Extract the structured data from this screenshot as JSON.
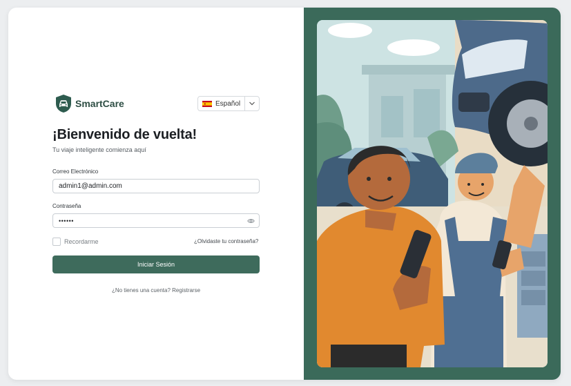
{
  "brand": {
    "name": "SmartCare",
    "logo_icon": "car-shield-icon",
    "color": "#2e4e44"
  },
  "language": {
    "selected": "Español",
    "flag_icon": "spain-flag-icon",
    "dropdown_icon": "chevron-down-icon"
  },
  "login": {
    "title": "¡Bienvenido de vuelta!",
    "subtitle": "Tu viaje inteligente comienza aquí",
    "email_label": "Correo Electrónico",
    "email_value": "admin1@admin.com",
    "password_label": "Contraseña",
    "password_masked": "••••••",
    "password_toggle_icon": "eye-icon",
    "remember_label": "Recordarme",
    "forgot_link": "¿Olvidaste tu contraseña?",
    "submit_label": "Iniciar Sesión",
    "signup_prompt": "¿No tienes una cuenta?",
    "signup_link": "Registrarse"
  },
  "colors": {
    "accent": "#3e6b5c",
    "panel": "#3b6a5a"
  },
  "illustration": {
    "icon": "mechanic-customer-illustration"
  }
}
